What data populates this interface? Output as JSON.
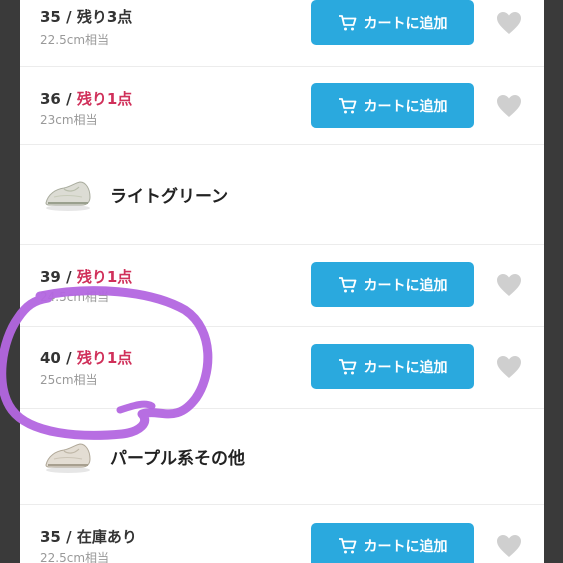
{
  "rows": [
    {
      "size": "35",
      "sep": " / ",
      "stock": "残り3点",
      "sub": "22.5cm相当",
      "button": "カートに追加"
    },
    {
      "size": "36",
      "sep": " / ",
      "stock": "残り1点",
      "sub": "23cm相当",
      "button": "カートに追加"
    },
    {
      "color_name": "ライトグリーン"
    },
    {
      "size": "39",
      "sep": " / ",
      "stock": "残り1点",
      "sub": "24.5cm相当",
      "button": "カートに追加"
    },
    {
      "size": "40",
      "sep": " / ",
      "stock": "残り1点",
      "sub": "25cm相当",
      "button": "カートに追加"
    },
    {
      "color_name": "パープル系その他"
    },
    {
      "size": "35",
      "sep": " / ",
      "stock": "在庫あり",
      "sub": "22.5cm相当",
      "button": "カートに追加"
    }
  ],
  "colors": {
    "button": "#2aa9de",
    "stock_low": "#d0305a",
    "heart": "#cfcfcf",
    "highlight_circle": "#b366e0"
  },
  "icons": [
    "cart-icon",
    "heart-icon",
    "shoe-thumbnail"
  ]
}
